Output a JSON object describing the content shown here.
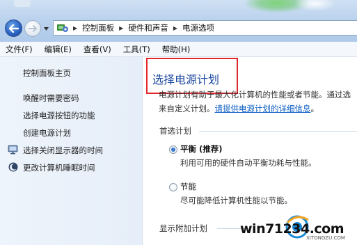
{
  "nav": {
    "breadcrumbs": [
      "控制面板",
      "硬件和声音",
      "电源选项"
    ]
  },
  "menubar": {
    "items": [
      "文件(F)",
      "编辑(E)",
      "查看(V)",
      "工具(T)",
      "帮助(H)"
    ]
  },
  "leftpane": {
    "home": "控制面板主页",
    "links": [
      "唤醒时需要密码",
      "选择电源按钮的功能",
      "创建电源计划",
      "选择关闭显示器的时间",
      "更改计算机睡眠时间"
    ]
  },
  "main": {
    "title": "选择电源计划",
    "desc_line1": "电源计划有助于最大化计算机的性能或者节能。通过选",
    "desc_line2_prefix": "来自定义计划。",
    "desc_link": "请提供电源计划的详细信息",
    "desc_line2_suffix": "。",
    "preferred_label": "首选计划",
    "plans": [
      {
        "name": "平衡 (推荐)",
        "desc": "利用可用的硬件自动平衡功耗与性能。",
        "selected": true
      },
      {
        "name": "节能",
        "desc": "尽可能降低计算机性能以节能。",
        "selected": false
      }
    ],
    "additional_label": "显示附加计划"
  },
  "watermark": {
    "text": "win71234.com",
    "sub": "XITONGZU.COM"
  },
  "colors": {
    "title": "#1f4aa0",
    "link": "#0d5fc4",
    "highlight": "#e3262c",
    "navbar": "#bcd3ee"
  }
}
